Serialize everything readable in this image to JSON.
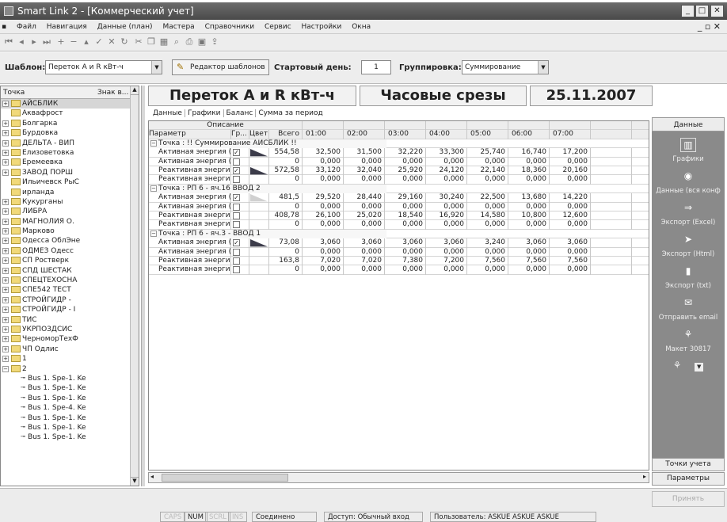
{
  "window": {
    "title": "Smart Link 2 - [Коммерческий учет]"
  },
  "menu": [
    "Файл",
    "Навигация",
    "Данные (план)",
    "Мастера",
    "Справочники",
    "Сервис",
    "Настройки",
    "Окна"
  ],
  "filter": {
    "template_label": "Шаблон:",
    "template_value": "Переток А и R кВт-ч",
    "template_editor": "Редактор шаблонов",
    "start_day_label": "Стартовый день:",
    "start_day_value": "1",
    "grouping_label": "Группировка:",
    "grouping_value": "Суммирование"
  },
  "tree": {
    "header": "Точка",
    "header2": "Знак в...",
    "items": [
      {
        "label": "АЙСБЛИК",
        "exp": "+",
        "folder": true
      },
      {
        "label": "Аквафрост",
        "exp": "",
        "folder": true
      },
      {
        "label": "Болгарка",
        "exp": "+",
        "folder": true
      },
      {
        "label": "Бурдовка",
        "exp": "+",
        "folder": true
      },
      {
        "label": "ДЕЛЬТА - ВИП",
        "exp": "+",
        "folder": true
      },
      {
        "label": "Елизоветовка",
        "exp": "+",
        "folder": true
      },
      {
        "label": "Еремеевка",
        "exp": "+",
        "folder": true
      },
      {
        "label": "ЗАВОД ПОРШ",
        "exp": "+",
        "folder": true
      },
      {
        "label": "Ильичевск РыС",
        "exp": "",
        "folder": true
      },
      {
        "label": "ирланда",
        "exp": "",
        "folder": true
      },
      {
        "label": "Кукурганы",
        "exp": "+",
        "folder": true
      },
      {
        "label": "ЛИБРА",
        "exp": "+",
        "folder": true
      },
      {
        "label": "МАГНОЛИЯ О.",
        "exp": "+",
        "folder": true
      },
      {
        "label": "Марково",
        "exp": "+",
        "folder": true
      },
      {
        "label": "Одесса ОблЭне",
        "exp": "+",
        "folder": true
      },
      {
        "label": "ОДМЕЗ Одесс",
        "exp": "+",
        "folder": true
      },
      {
        "label": "СП Ростверк",
        "exp": "+",
        "folder": true
      },
      {
        "label": "СПД ШЕСТАК",
        "exp": "+",
        "folder": true
      },
      {
        "label": "СПЕЦТЕХОСНА",
        "exp": "+",
        "folder": true
      },
      {
        "label": "СПЕ542 ТЕСТ",
        "exp": "+",
        "folder": true
      },
      {
        "label": "СТРОЙГИДР -",
        "exp": "+",
        "folder": true
      },
      {
        "label": "СТРОЙГИДР - I",
        "exp": "+",
        "folder": true
      },
      {
        "label": "ТИС",
        "exp": "+",
        "folder": true
      },
      {
        "label": "УКРПОЗДСИС",
        "exp": "+",
        "folder": true
      },
      {
        "label": "ЧерноморТехФ",
        "exp": "+",
        "folder": true
      },
      {
        "label": "ЧП Одлис",
        "exp": "+",
        "folder": true
      },
      {
        "label": "1",
        "exp": "+",
        "folder": true
      },
      {
        "label": "2",
        "exp": "-",
        "folder": true
      },
      {
        "label": "Bus 1. Spe-1. Ke",
        "exp": "",
        "folder": false
      },
      {
        "label": "Bus 1. Spe-1. Ke",
        "exp": "",
        "folder": false
      },
      {
        "label": "Bus 1. Spe-1. Ke",
        "exp": "",
        "folder": false
      },
      {
        "label": "Bus 1. Spe-4. Ke",
        "exp": "",
        "folder": false
      },
      {
        "label": "Bus 1. Spe-1. Ke",
        "exp": "",
        "folder": false
      },
      {
        "label": "Bus 1. Spe-1. Ke",
        "exp": "",
        "folder": false
      },
      {
        "label": "Bus 1. Spe-1. Ke",
        "exp": "",
        "folder": false
      }
    ]
  },
  "header": {
    "title": "Переток А и R кВт-ч",
    "mode": "Часовые срезы",
    "date": "25.11.2007"
  },
  "tabs": [
    "Данные",
    "Графики",
    "Баланс",
    "Сумма за период"
  ],
  "grid": {
    "desc_header": "Описание",
    "columns": [
      "Параметр",
      "Гр...",
      "Цвет",
      "Всего",
      "01:00",
      "02:00",
      "03:00",
      "04:00",
      "05:00",
      "06:00",
      "07:00"
    ],
    "rows": [
      {
        "type": "group",
        "label": "Точка : !! Суммирование АЙСБЛИК !!"
      },
      {
        "type": "data",
        "param": "Активная энергия (+) а",
        "checked": true,
        "swatch": "#3c3c4a",
        "total": "554,58",
        "vals": [
          "32,500",
          "31,500",
          "32,220",
          "33,300",
          "25,740",
          "16,740",
          "17,200"
        ]
      },
      {
        "type": "data",
        "param": "Активная энергия (-) ак",
        "checked": false,
        "swatch": "",
        "total": "0",
        "vals": [
          "0,000",
          "0,000",
          "0,000",
          "0,000",
          "0,000",
          "0,000",
          "0,000"
        ]
      },
      {
        "type": "data",
        "param": "Реактивная энергия (+",
        "checked": true,
        "swatch": "#3c3c4a",
        "total": "572,58",
        "vals": [
          "33,120",
          "32,040",
          "25,920",
          "24,120",
          "22,140",
          "18,360",
          "20,160"
        ]
      },
      {
        "type": "data",
        "param": "Реактивная энергия (-)",
        "checked": false,
        "swatch": "",
        "total": "0",
        "vals": [
          "0,000",
          "0,000",
          "0,000",
          "0,000",
          "0,000",
          "0,000",
          "0,000"
        ]
      },
      {
        "type": "group",
        "label": "Точка : РП 6 - яч.16 ВВОД 2"
      },
      {
        "type": "data",
        "param": "Активная энергия (+) а",
        "checked": true,
        "swatch": "#d0d0d0",
        "total": "481,5",
        "vals": [
          "29,520",
          "28,440",
          "29,160",
          "30,240",
          "22,500",
          "13,680",
          "14,220"
        ]
      },
      {
        "type": "data",
        "param": "Активная энергия (-) ак",
        "checked": false,
        "swatch": "",
        "total": "0",
        "vals": [
          "0,000",
          "0,000",
          "0,000",
          "0,000",
          "0,000",
          "0,000",
          "0,000"
        ]
      },
      {
        "type": "data",
        "param": "Реактивная энергия (+",
        "checked": false,
        "swatch": "",
        "total": "408,78",
        "vals": [
          "26,100",
          "25,020",
          "18,540",
          "16,920",
          "14,580",
          "10,800",
          "12,600"
        ]
      },
      {
        "type": "data",
        "param": "Реактивная энергия (-)",
        "checked": false,
        "swatch": "",
        "total": "0",
        "vals": [
          "0,000",
          "0,000",
          "0,000",
          "0,000",
          "0,000",
          "0,000",
          "0,000"
        ]
      },
      {
        "type": "group",
        "label": "Точка : РП 6 - яч.3 - ВВОД 1"
      },
      {
        "type": "data",
        "param": "Активная энергия (+) а",
        "checked": true,
        "swatch": "#3c3c4a",
        "total": "73,08",
        "vals": [
          "3,060",
          "3,060",
          "3,060",
          "3,060",
          "3,240",
          "3,060",
          "3,060"
        ]
      },
      {
        "type": "data",
        "param": "Активная энергия (-) ак",
        "checked": false,
        "swatch": "",
        "total": "0",
        "vals": [
          "0,000",
          "0,000",
          "0,000",
          "0,000",
          "0,000",
          "0,000",
          "0,000"
        ]
      },
      {
        "type": "data",
        "param": "Реактивная энергия (+",
        "checked": false,
        "swatch": "",
        "total": "163,8",
        "vals": [
          "7,020",
          "7,020",
          "7,380",
          "7,200",
          "7,560",
          "7,560",
          "7,560"
        ]
      },
      {
        "type": "data",
        "param": "Реактивная энергия (-)",
        "checked": false,
        "swatch": "",
        "total": "0",
        "vals": [
          "0,000",
          "0,000",
          "0,000",
          "0,000",
          "0,000",
          "0,000",
          "0,000"
        ]
      }
    ]
  },
  "right_panel": {
    "header": "Данные",
    "items": [
      {
        "label": "Графики",
        "icon": "chart-icon"
      },
      {
        "label": "Данные (вся конф",
        "icon": "data-icon"
      },
      {
        "label": "Экспорт (Excel)",
        "icon": "export-excel-icon"
      },
      {
        "label": "Экспорт (Html)",
        "icon": "export-html-icon"
      },
      {
        "label": "Экспорт (txt)",
        "icon": "export-txt-icon"
      },
      {
        "label": "Отправить email",
        "icon": "email-icon"
      },
      {
        "label": "Макет 30817",
        "icon": "layout-icon"
      }
    ],
    "tab_points": "Точки учета",
    "tab_params": "Параметры",
    "apply": "Принять"
  },
  "status": {
    "caps": "CAPS",
    "num": "NUM",
    "scrl": "SCRL",
    "ins": "INS",
    "connection": "Соединено",
    "access": "Доступ: Обычный вход",
    "user": "Пользователь: ASKUE ASKUE ASKUE"
  }
}
